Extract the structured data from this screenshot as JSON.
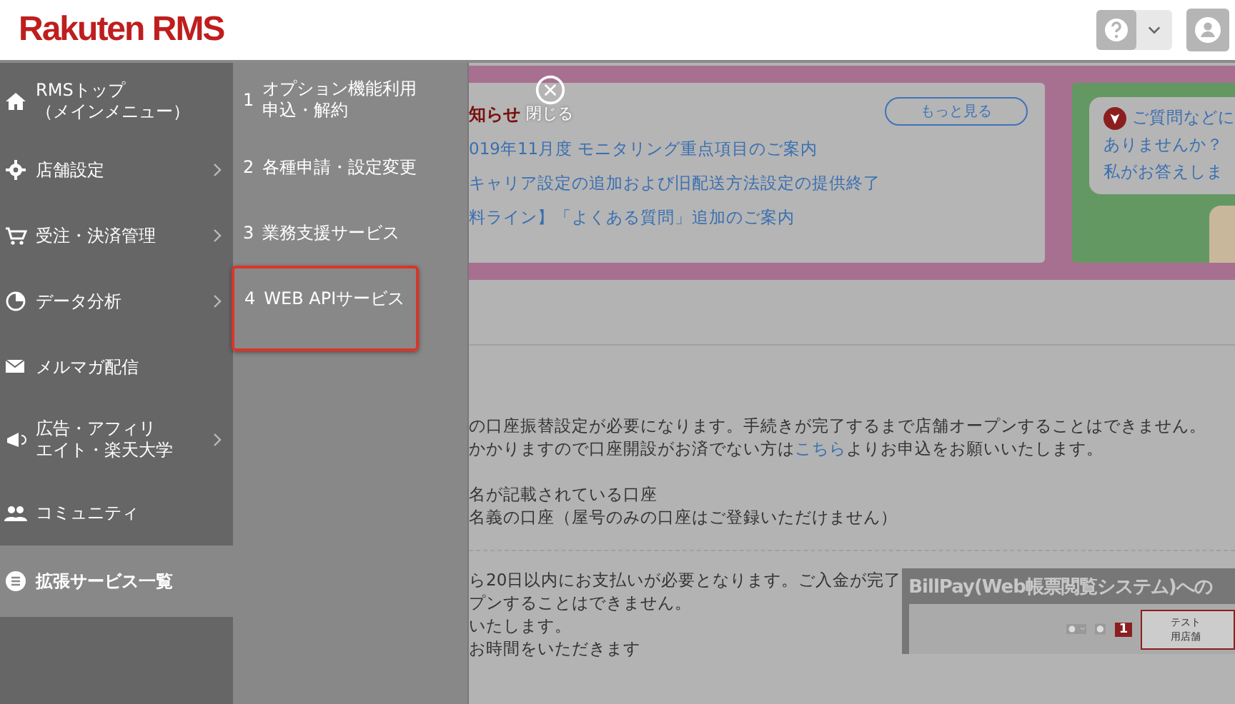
{
  "header": {
    "logo": "Rakuten RMS"
  },
  "menu": {
    "items": [
      {
        "lines": [
          "RMSトップ",
          "（メインメニュー）"
        ],
        "chevron": false,
        "selected": false
      },
      {
        "lines": [
          "店舗設定"
        ],
        "chevron": true,
        "selected": false
      },
      {
        "lines": [
          "受注・決済管理"
        ],
        "chevron": true,
        "selected": false
      },
      {
        "lines": [
          "データ分析"
        ],
        "chevron": true,
        "selected": false
      },
      {
        "lines": [
          "メルマガ配信"
        ],
        "chevron": false,
        "selected": false
      },
      {
        "lines": [
          "広告・アフィリ",
          "エイト・楽天大学"
        ],
        "chevron": true,
        "selected": false
      },
      {
        "lines": [
          "コミュニティ"
        ],
        "chevron": false,
        "selected": false
      },
      {
        "lines": [
          "拡張サービス一覧"
        ],
        "chevron": false,
        "selected": true
      }
    ]
  },
  "submenu": {
    "items": [
      {
        "number": "1",
        "lines": [
          "オプション機能利用",
          "申込・解約"
        ],
        "annotated": false
      },
      {
        "number": "2",
        "lines": [
          "各種申請・設定変更"
        ],
        "annotated": false
      },
      {
        "number": "3",
        "lines": [
          "業務支援サービス"
        ],
        "annotated": false
      },
      {
        "number": "4",
        "lines": [
          "WEB APIサービス"
        ],
        "annotated": true
      }
    ]
  },
  "close": {
    "label": "閉じる"
  },
  "notice": {
    "title": "知らせ",
    "more_button": "もっと見る",
    "links": [
      "019年11月度 モニタリング重点項目のご案内",
      "キャリア設定の追加および旧配送方法設定の提供終了",
      "料ライン】「よくある質問」追加のご案内"
    ]
  },
  "help_card": {
    "lines": [
      "ご質問などに",
      "ありませんか？",
      "私がお答えしま"
    ]
  },
  "body": {
    "paragraph_1": [
      "の口座振替設定が必要になります。手続きが完了するまで店舗オープンすることはできません。"
    ],
    "paragraph_2": {
      "before": "かかりますので口座開設がお済でない方は",
      "link": "こちら",
      "after": "よりお申込をお願いいたします。"
    },
    "list": [
      "名が記載されている口座",
      "名義の口座（屋号のみの口座はご登録いただけません）"
    ],
    "paragraph_3": [
      "ら20日以内にお支払いが必要となります。ご入金が完了",
      "プンすることはできません。",
      "いたします。",
      "お時間をいただきます"
    ]
  },
  "billpay": {
    "title": "BillPay(Web帳票閲覧システム)への",
    "badge": "1",
    "shop": "テスト用店舗"
  }
}
